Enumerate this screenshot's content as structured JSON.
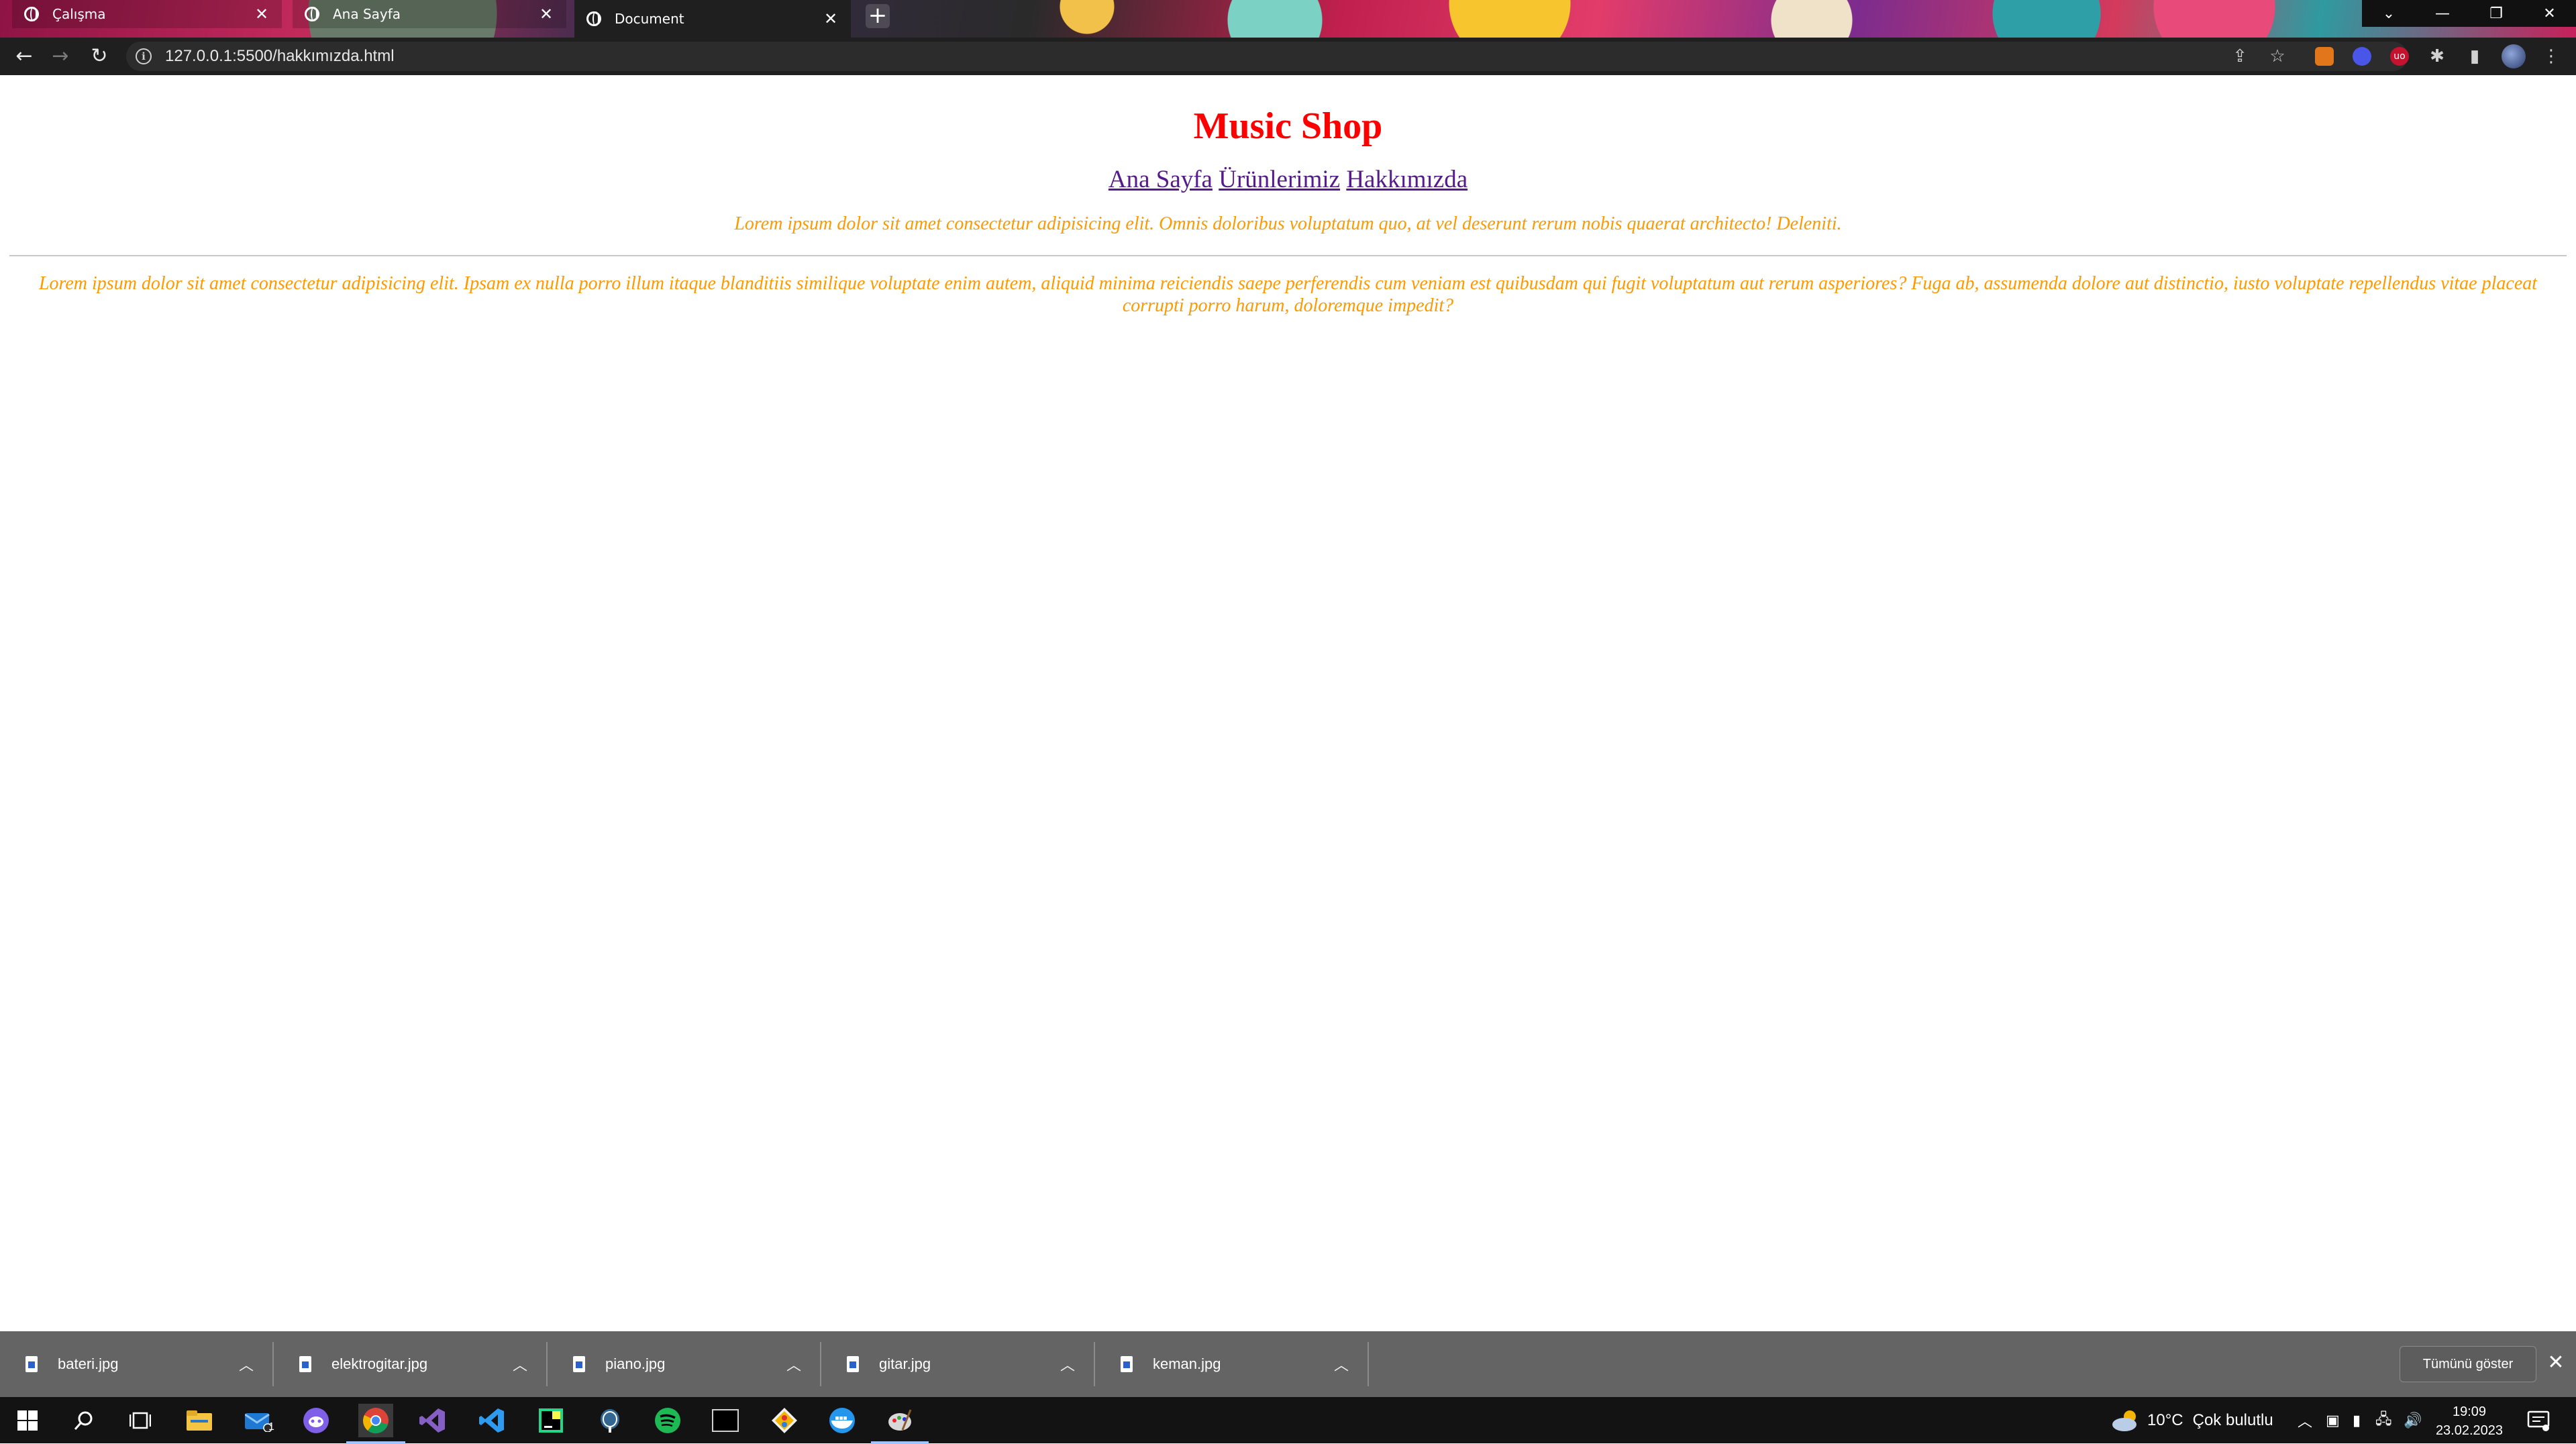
{
  "browser": {
    "tabs": [
      {
        "title": "Çalışma"
      },
      {
        "title": "Ana Sayfa"
      },
      {
        "title": "Document"
      }
    ],
    "url": "127.0.0.1:5500/hakkımızda.html"
  },
  "page": {
    "title": "Music Shop",
    "nav": [
      "Ana Sayfa",
      "Ürünlerimiz",
      "Hakkımızda"
    ],
    "intro": "Lorem ipsum dolor sit amet consectetur adipisicing elit. Omnis doloribus voluptatum quo, at vel deserunt rerum nobis quaerat architecto! Deleniti.",
    "body": "Lorem ipsum dolor sit amet consectetur adipisicing elit. Ipsam ex nulla porro illum itaque blanditiis similique voluptate enim autem, aliquid minima reiciendis saepe perferendis cum veniam est quibusdam qui fugit voluptatum aut rerum asperiores? Fuga ab, assumenda dolore aut distinctio, iusto voluptate repellendus vitae placeat corrupti porro harum, doloremque impedit?",
    "colors": {
      "title": "#ff0000",
      "text": "#ff9900",
      "link": "#551a8b"
    }
  },
  "downloads": {
    "files": [
      "bateri.jpg",
      "elektrogitar.jpg",
      "piano.jpg",
      "gitar.jpg",
      "keman.jpg"
    ],
    "show_all": "Tümünü göster"
  },
  "taskbar": {
    "weather": "10°C",
    "weather_desc": "Çok bulutlu",
    "time": "19:09",
    "date": "23.02.2023",
    "mail_badge": "1"
  }
}
